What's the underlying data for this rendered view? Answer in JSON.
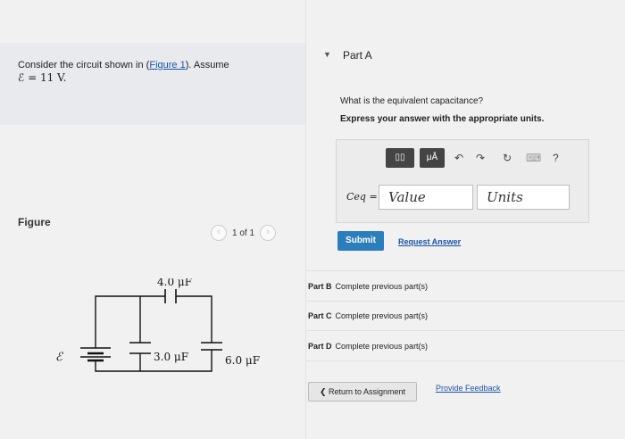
{
  "question": {
    "text_before": "Consider the circuit shown in (",
    "figure_link": "Figure 1",
    "text_after": "). Assume",
    "emf_line": "ℰ = 11 V."
  },
  "figure": {
    "label": "Figure",
    "pager": "1 of 1",
    "prev": "‹",
    "next": "›"
  },
  "circuit": {
    "emf_symbol": "ℰ",
    "c1": "4.0 μF",
    "c2": "3.0 μF",
    "c3": "6.0 μF"
  },
  "part_a": {
    "title": "Part A",
    "prompt": "What is the equivalent capacitance?",
    "instruction": "Express your answer with the appropriate units.",
    "toolbar": {
      "template_btn": "▯▯",
      "units_btn": "μÅ",
      "undo": "↶",
      "redo": "↷",
      "reset": "↻",
      "keyboard": "⌨",
      "help": "?"
    },
    "variable_label": "Ceq =",
    "value_placeholder": "Value",
    "units_placeholder": "Units",
    "submit": "Submit",
    "request_answer": "Request Answer"
  },
  "other_parts": [
    {
      "name": "Part B",
      "status": "Complete previous part(s)"
    },
    {
      "name": "Part C",
      "status": "Complete previous part(s)"
    },
    {
      "name": "Part D",
      "status": "Complete previous part(s)"
    }
  ],
  "footer": {
    "return": "❮ Return to Assignment",
    "feedback": "Provide Feedback"
  }
}
